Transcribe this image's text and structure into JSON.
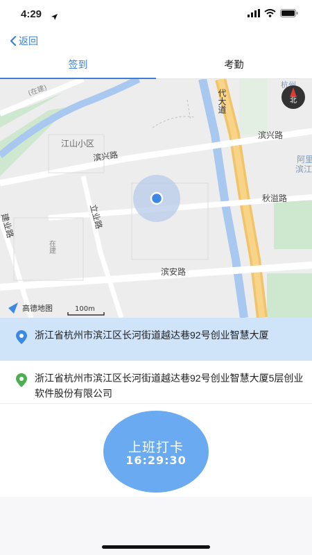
{
  "status": {
    "time": "4:29"
  },
  "nav": {
    "back_label": "返回"
  },
  "tabs": [
    {
      "label": "签到",
      "active": true
    },
    {
      "label": "考勤",
      "active": false
    }
  ],
  "map": {
    "labels": {
      "jiangshan": "江山小区",
      "binxing_w": "滨兴路",
      "binxing_e": "滨兴路",
      "liye": "立业路",
      "qiuyi": "秋溢路",
      "binan": "滨安路",
      "jianye": "建业路",
      "daidao": "代大道",
      "hangzhou": "杭州",
      "ali": "阿里",
      "bin": "滨江",
      "zai": "在建",
      "top": "(在建)",
      "compass": "北",
      "logo": "高德地图",
      "scale": "100m"
    }
  },
  "addresses": [
    {
      "text": "浙江省杭州市滨江区长河街道越达巷92号创业智慧大厦",
      "pin_color": "#3b88e6"
    },
    {
      "text": "浙江省杭州市滨江区长河街道越达巷92号创业智慧大厦5层创业软件股份有限公司",
      "pin_color": "#4caf50"
    }
  ],
  "punch": {
    "label": "上班打卡",
    "time": "16:29:30"
  }
}
